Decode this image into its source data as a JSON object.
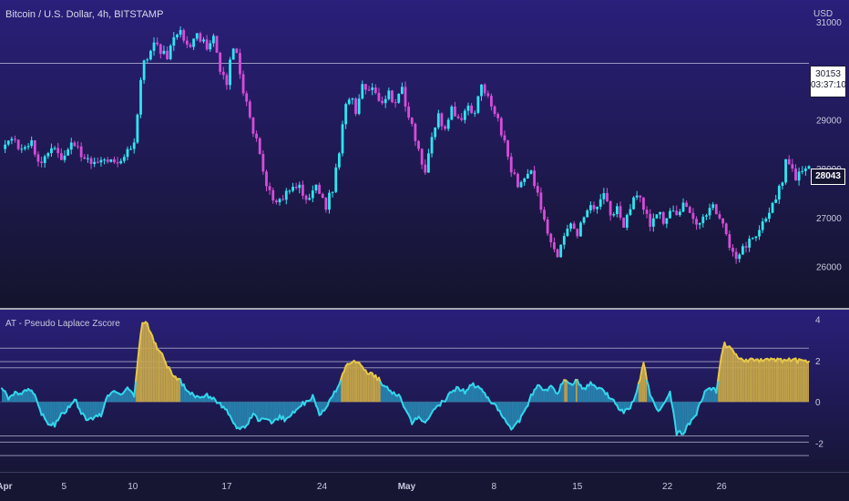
{
  "header": {
    "symbol_title": "Bitcoin / U.S. Dollar, 4h, BITSTAMP",
    "currency": "USD",
    "indicator_title": "AT - Pseudo Laplace Zscore"
  },
  "price_tags": {
    "last_price": "30153",
    "countdown": "03:37:10",
    "current_price": "28043"
  },
  "colors": {
    "background_top": "#2a1f7a",
    "background_bottom": "#14142c",
    "candle_up": "#2ee6f0",
    "candle_down": "#d64dd8",
    "osc_line": "#33d6ec",
    "osc_fill": "#2aa0c8",
    "osc_extreme_line": "#e6c84a",
    "osc_extreme_fill": "#c9a94a",
    "guide_line": "#b9b9d6"
  },
  "chart_data": [
    {
      "type": "candlestick",
      "title": "Bitcoin / U.S. Dollar, 4h, BITSTAMP",
      "y_axis": {
        "ticks": [
          26000,
          27000,
          28000,
          29000,
          30000,
          31000
        ],
        "ylim": [
          25300,
          31300
        ],
        "position": "right",
        "unit": "USD"
      },
      "x_axis": {
        "tick_labels": [
          "Apr",
          "5",
          "10",
          "17",
          "24",
          "May",
          "8",
          "15",
          "22",
          "26"
        ]
      },
      "horizontal_line": 30153,
      "current_price": 28043,
      "close_path": [
        {
          "d": 0,
          "v": 28400
        },
        {
          "d": 0.8,
          "v": 28650
        },
        {
          "d": 1.5,
          "v": 28350
        },
        {
          "d": 2.3,
          "v": 28500
        },
        {
          "d": 3,
          "v": 28050
        },
        {
          "d": 3.8,
          "v": 28450
        },
        {
          "d": 4.5,
          "v": 28250
        },
        {
          "d": 5.3,
          "v": 28550
        },
        {
          "d": 6,
          "v": 28300
        },
        {
          "d": 7,
          "v": 28100
        },
        {
          "d": 8,
          "v": 28200
        },
        {
          "d": 9,
          "v": 28150
        },
        {
          "d": 10,
          "v": 28500
        },
        {
          "d": 10.3,
          "v": 29300
        },
        {
          "d": 10.6,
          "v": 30200
        },
        {
          "d": 11,
          "v": 30150
        },
        {
          "d": 11.5,
          "v": 30600
        },
        {
          "d": 12,
          "v": 30400
        },
        {
          "d": 12.5,
          "v": 30300
        },
        {
          "d": 13,
          "v": 30700
        },
        {
          "d": 13.5,
          "v": 30850
        },
        {
          "d": 14,
          "v": 30450
        },
        {
          "d": 14.7,
          "v": 30700
        },
        {
          "d": 15.5,
          "v": 30500
        },
        {
          "d": 16,
          "v": 30650
        },
        {
          "d": 16.5,
          "v": 29950
        },
        {
          "d": 17,
          "v": 29700
        },
        {
          "d": 17.3,
          "v": 30300
        },
        {
          "d": 17.6,
          "v": 30600
        },
        {
          "d": 18,
          "v": 29900
        },
        {
          "d": 18.5,
          "v": 29300
        },
        {
          "d": 19,
          "v": 28800
        },
        {
          "d": 19.5,
          "v": 28300
        },
        {
          "d": 20,
          "v": 27700
        },
        {
          "d": 20.7,
          "v": 27300
        },
        {
          "d": 21.5,
          "v": 27500
        },
        {
          "d": 22.3,
          "v": 27700
        },
        {
          "d": 23,
          "v": 27350
        },
        {
          "d": 23.8,
          "v": 27600
        },
        {
          "d": 24.5,
          "v": 27250
        },
        {
          "d": 25,
          "v": 27600
        },
        {
          "d": 25.5,
          "v": 28400
        },
        {
          "d": 26,
          "v": 29300
        },
        {
          "d": 26.4,
          "v": 29600
        },
        {
          "d": 26.8,
          "v": 29050
        },
        {
          "d": 27.2,
          "v": 29850
        },
        {
          "d": 27.6,
          "v": 29450
        },
        {
          "d": 28,
          "v": 29700
        },
        {
          "d": 28.6,
          "v": 29300
        },
        {
          "d": 29.2,
          "v": 29550
        },
        {
          "d": 29.7,
          "v": 29250
        },
        {
          "d": 30.2,
          "v": 29700
        },
        {
          "d": 30.7,
          "v": 29100
        },
        {
          "d": 31.2,
          "v": 28700
        },
        {
          "d": 31.6,
          "v": 28200
        },
        {
          "d": 32,
          "v": 28000
        },
        {
          "d": 32.5,
          "v": 28600
        },
        {
          "d": 33,
          "v": 29100
        },
        {
          "d": 33.5,
          "v": 28800
        },
        {
          "d": 34,
          "v": 29250
        },
        {
          "d": 34.6,
          "v": 28900
        },
        {
          "d": 35.2,
          "v": 29400
        },
        {
          "d": 35.7,
          "v": 29100
        },
        {
          "d": 36.2,
          "v": 29650
        },
        {
          "d": 36.6,
          "v": 29500
        },
        {
          "d": 37,
          "v": 29250
        },
        {
          "d": 37.5,
          "v": 29000
        },
        {
          "d": 38,
          "v": 28500
        },
        {
          "d": 38.5,
          "v": 28000
        },
        {
          "d": 39,
          "v": 27650
        },
        {
          "d": 39.6,
          "v": 27750
        },
        {
          "d": 40,
          "v": 27950
        },
        {
          "d": 40.5,
          "v": 27450
        },
        {
          "d": 41,
          "v": 27000
        },
        {
          "d": 41.5,
          "v": 26500
        },
        {
          "d": 42,
          "v": 26150
        },
        {
          "d": 42.5,
          "v": 26700
        },
        {
          "d": 43,
          "v": 26900
        },
        {
          "d": 43.5,
          "v": 26650
        },
        {
          "d": 44,
          "v": 27000
        },
        {
          "d": 44.5,
          "v": 27300
        },
        {
          "d": 45,
          "v": 27150
        },
        {
          "d": 45.5,
          "v": 27450
        },
        {
          "d": 46,
          "v": 27050
        },
        {
          "d": 46.5,
          "v": 27250
        },
        {
          "d": 47,
          "v": 26850
        },
        {
          "d": 47.5,
          "v": 27200
        },
        {
          "d": 48,
          "v": 27500
        },
        {
          "d": 48.5,
          "v": 27150
        },
        {
          "d": 49,
          "v": 26900
        },
        {
          "d": 49.5,
          "v": 27100
        },
        {
          "d": 50,
          "v": 26950
        },
        {
          "d": 50.5,
          "v": 27200
        },
        {
          "d": 51,
          "v": 27050
        },
        {
          "d": 51.5,
          "v": 27300
        },
        {
          "d": 52,
          "v": 27050
        },
        {
          "d": 52.5,
          "v": 26850
        },
        {
          "d": 53,
          "v": 27000
        },
        {
          "d": 53.5,
          "v": 27250
        },
        {
          "d": 54,
          "v": 27150
        },
        {
          "d": 54.5,
          "v": 26850
        },
        {
          "d": 55,
          "v": 26450
        },
        {
          "d": 55.5,
          "v": 26100
        },
        {
          "d": 56,
          "v": 26350
        },
        {
          "d": 56.5,
          "v": 26550
        },
        {
          "d": 57,
          "v": 26650
        },
        {
          "d": 57.5,
          "v": 26850
        },
        {
          "d": 58,
          "v": 27050
        },
        {
          "d": 58.5,
          "v": 27400
        },
        {
          "d": 59,
          "v": 27800
        },
        {
          "d": 59.3,
          "v": 28350
        },
        {
          "d": 59.7,
          "v": 27950
        },
        {
          "d": 60,
          "v": 27800
        },
        {
          "d": 60.5,
          "v": 27950
        },
        {
          "d": 61,
          "v": 28043
        }
      ]
    },
    {
      "type": "area",
      "title": "AT - Pseudo Laplace Zscore",
      "y_axis": {
        "ticks": [
          4,
          2,
          0,
          -2
        ],
        "ylim": [
          -3.3,
          4.2
        ],
        "position": "right"
      },
      "guide_levels": [
        2.6,
        1.95,
        1.65,
        -1.65,
        -1.95,
        -2.6
      ],
      "extreme_threshold": 1.0,
      "z_path": [
        {
          "d": 0,
          "v": 0.7
        },
        {
          "d": 0.5,
          "v": 0.2
        },
        {
          "d": 1,
          "v": 0.5
        },
        {
          "d": 1.5,
          "v": 0.3
        },
        {
          "d": 2,
          "v": 0.7
        },
        {
          "d": 2.5,
          "v": 0.3
        },
        {
          "d": 3,
          "v": -0.6
        },
        {
          "d": 3.5,
          "v": -1.0
        },
        {
          "d": 4,
          "v": -1.1
        },
        {
          "d": 4.5,
          "v": -0.6
        },
        {
          "d": 5,
          "v": -0.3
        },
        {
          "d": 5.5,
          "v": 0.2
        },
        {
          "d": 6,
          "v": -0.5
        },
        {
          "d": 6.5,
          "v": -0.9
        },
        {
          "d": 7,
          "v": -0.8
        },
        {
          "d": 7.5,
          "v": -0.6
        },
        {
          "d": 8,
          "v": 0.3
        },
        {
          "d": 8.5,
          "v": 0.6
        },
        {
          "d": 9,
          "v": 0.4
        },
        {
          "d": 9.5,
          "v": 0.7
        },
        {
          "d": 10,
          "v": 0.2
        },
        {
          "d": 10.3,
          "v": 2.2
        },
        {
          "d": 10.6,
          "v": 3.9
        },
        {
          "d": 11,
          "v": 3.8
        },
        {
          "d": 11.5,
          "v": 2.9
        },
        {
          "d": 12,
          "v": 2.4
        },
        {
          "d": 12.5,
          "v": 1.7
        },
        {
          "d": 13,
          "v": 1.2
        },
        {
          "d": 13.5,
          "v": 1.0
        },
        {
          "d": 14,
          "v": 0.5
        },
        {
          "d": 14.5,
          "v": 0.3
        },
        {
          "d": 15,
          "v": 0.2
        },
        {
          "d": 15.5,
          "v": 0.3
        },
        {
          "d": 16,
          "v": 0.1
        },
        {
          "d": 16.5,
          "v": -0.1
        },
        {
          "d": 17,
          "v": -0.4
        },
        {
          "d": 17.5,
          "v": -1.0
        },
        {
          "d": 18,
          "v": -1.4
        },
        {
          "d": 18.5,
          "v": -1.1
        },
        {
          "d": 19,
          "v": -0.6
        },
        {
          "d": 19.5,
          "v": -0.9
        },
        {
          "d": 20,
          "v": -0.8
        },
        {
          "d": 20.5,
          "v": -1.0
        },
        {
          "d": 21,
          "v": -0.7
        },
        {
          "d": 21.5,
          "v": -0.9
        },
        {
          "d": 22,
          "v": -0.5
        },
        {
          "d": 22.5,
          "v": -0.2
        },
        {
          "d": 23,
          "v": 0.0
        },
        {
          "d": 23.5,
          "v": 0.3
        },
        {
          "d": 24,
          "v": -0.6
        },
        {
          "d": 24.5,
          "v": -0.3
        },
        {
          "d": 25,
          "v": 0.3
        },
        {
          "d": 25.5,
          "v": 0.8
        },
        {
          "d": 26,
          "v": 1.7
        },
        {
          "d": 26.5,
          "v": 1.9
        },
        {
          "d": 27,
          "v": 2.0
        },
        {
          "d": 27.5,
          "v": 1.5
        },
        {
          "d": 28,
          "v": 1.3
        },
        {
          "d": 28.5,
          "v": 1.1
        },
        {
          "d": 29,
          "v": 0.7
        },
        {
          "d": 29.5,
          "v": 0.5
        },
        {
          "d": 30,
          "v": 0.3
        },
        {
          "d": 30.5,
          "v": -0.3
        },
        {
          "d": 31,
          "v": -1.0
        },
        {
          "d": 31.5,
          "v": -0.7
        },
        {
          "d": 32,
          "v": -1.0
        },
        {
          "d": 32.5,
          "v": -0.5
        },
        {
          "d": 33,
          "v": -0.2
        },
        {
          "d": 33.5,
          "v": 0.1
        },
        {
          "d": 34,
          "v": 0.5
        },
        {
          "d": 34.5,
          "v": 0.7
        },
        {
          "d": 35,
          "v": 0.5
        },
        {
          "d": 35.5,
          "v": 0.9
        },
        {
          "d": 36,
          "v": 0.7
        },
        {
          "d": 36.5,
          "v": 0.4
        },
        {
          "d": 37,
          "v": 0.0
        },
        {
          "d": 37.5,
          "v": -0.4
        },
        {
          "d": 38,
          "v": -0.9
        },
        {
          "d": 38.5,
          "v": -1.3
        },
        {
          "d": 39,
          "v": -1.0
        },
        {
          "d": 39.5,
          "v": -0.5
        },
        {
          "d": 40,
          "v": 0.3
        },
        {
          "d": 40.5,
          "v": 0.8
        },
        {
          "d": 41,
          "v": 0.5
        },
        {
          "d": 41.5,
          "v": 0.8
        },
        {
          "d": 42,
          "v": 0.4
        },
        {
          "d": 42.5,
          "v": 1.1
        },
        {
          "d": 43,
          "v": 0.9
        },
        {
          "d": 43.5,
          "v": 1.0
        },
        {
          "d": 44,
          "v": 0.6
        },
        {
          "d": 44.5,
          "v": 0.9
        },
        {
          "d": 45,
          "v": 0.7
        },
        {
          "d": 45.5,
          "v": 0.5
        },
        {
          "d": 46,
          "v": 0.2
        },
        {
          "d": 46.5,
          "v": -0.2
        },
        {
          "d": 47,
          "v": -0.5
        },
        {
          "d": 47.5,
          "v": -0.3
        },
        {
          "d": 48,
          "v": 0.5
        },
        {
          "d": 48.5,
          "v": 1.9
        },
        {
          "d": 48.8,
          "v": 0.9
        },
        {
          "d": 49,
          "v": 0.3
        },
        {
          "d": 49.5,
          "v": -0.4
        },
        {
          "d": 50,
          "v": -0.2
        },
        {
          "d": 50.5,
          "v": 0.4
        },
        {
          "d": 50.8,
          "v": -0.6
        },
        {
          "d": 51,
          "v": -1.5
        },
        {
          "d": 51.5,
          "v": -1.5
        },
        {
          "d": 52,
          "v": -1.0
        },
        {
          "d": 52.5,
          "v": -0.6
        },
        {
          "d": 53,
          "v": 0.3
        },
        {
          "d": 53.5,
          "v": 0.7
        },
        {
          "d": 54,
          "v": 0.5
        },
        {
          "d": 54.3,
          "v": 2.0
        },
        {
          "d": 54.6,
          "v": 2.8
        },
        {
          "d": 55,
          "v": 2.6
        },
        {
          "d": 55.5,
          "v": 2.3
        },
        {
          "d": 56,
          "v": 2.0
        }
      ]
    }
  ]
}
